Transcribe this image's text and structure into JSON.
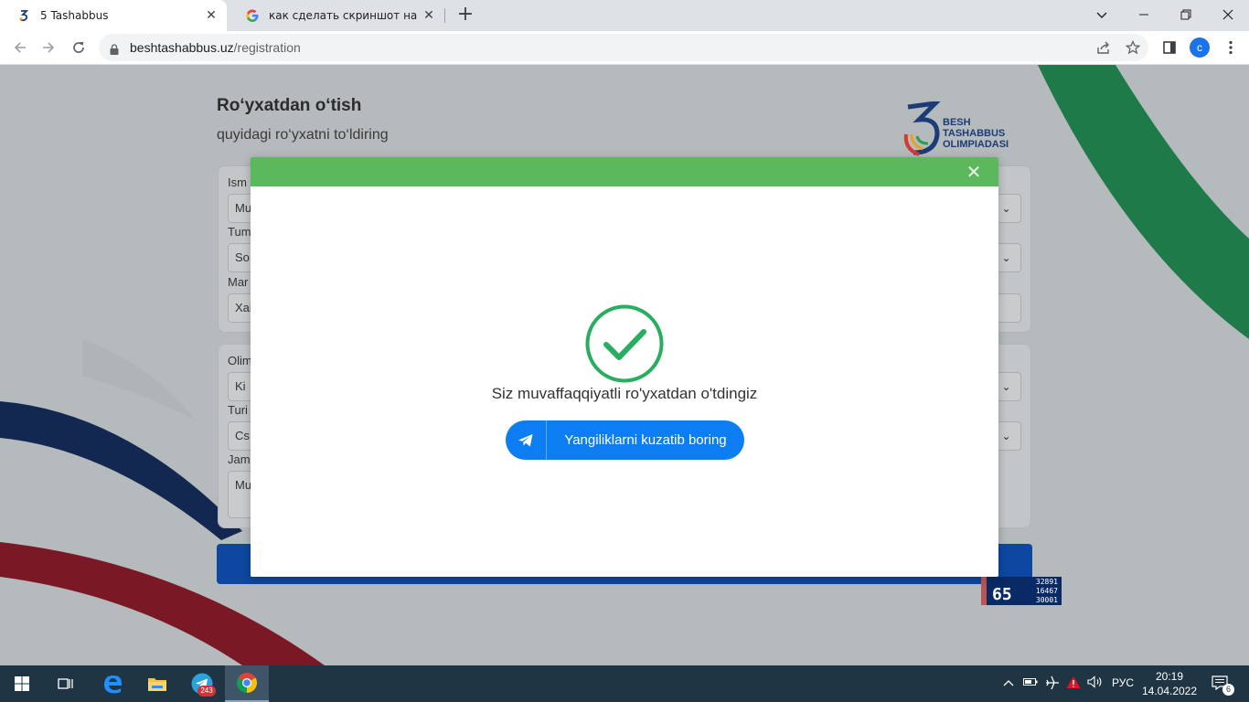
{
  "browser": {
    "tabs": [
      {
        "title": "5 Tashabbus",
        "favicon": "five-tashabbus-favicon",
        "active": true
      },
      {
        "title": "как сделать скриншот на ноутбу",
        "favicon": "google-favicon",
        "active": false
      }
    ],
    "url_host": "beshtashabbus.uz",
    "url_path": "/registration",
    "profile_initial": "c"
  },
  "page": {
    "title": "Ro‘yxatdan o‘tish",
    "subtitle": "quyidagi ro‘yxatni to‘ldiring",
    "logo": {
      "line1": "BESH",
      "line2": "TASHABBUS",
      "line3": "OLIMPIADASI"
    },
    "form1": {
      "fields": [
        {
          "label": "Ism",
          "value": "Mu"
        },
        {
          "label": "Tum",
          "value": "So"
        },
        {
          "label": "Mar",
          "value": "Xai"
        }
      ]
    },
    "form2": {
      "fields": [
        {
          "label": "Olim",
          "value": "Ki"
        },
        {
          "label": "Turi",
          "value": "Cs"
        },
        {
          "label": "Jam",
          "value": "Mu"
        }
      ]
    },
    "counter": {
      "big": "65",
      "lines": [
        "32891",
        "16467",
        "30001"
      ]
    }
  },
  "modal": {
    "message": "Siz muvaffaqqiyatli ro'yxatdan o'tdingiz",
    "button_label": "Yangiliklarni kuzatib boring",
    "header_color": "#5cb85c",
    "check_color": "#27ae60",
    "button_color": "#0d7ef2"
  },
  "taskbar": {
    "telegram_badge": "243",
    "language": "РУС",
    "time": "20:19",
    "date": "14.04.2022",
    "notifications": "6"
  }
}
